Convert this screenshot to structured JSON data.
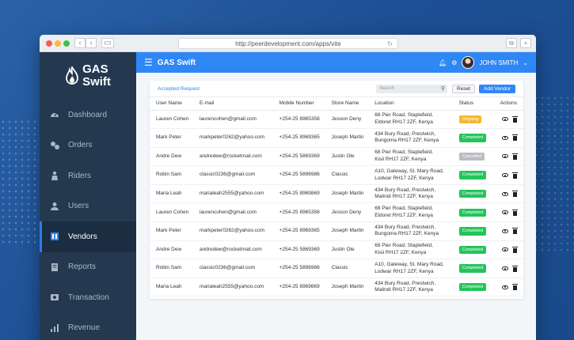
{
  "browser": {
    "url": "http://peerdevelopment.com/apps/vite"
  },
  "brand": {
    "line1": "GAS",
    "line2": "Swift"
  },
  "sidebar": {
    "items": [
      {
        "label": "Dashboard",
        "icon": "gauge-icon"
      },
      {
        "label": "Orders",
        "icon": "orders-icon"
      },
      {
        "label": "Riders",
        "icon": "rider-icon"
      },
      {
        "label": "Users",
        "icon": "user-icon"
      },
      {
        "label": "Vendors",
        "icon": "vendor-icon",
        "active": true
      },
      {
        "label": "Reports",
        "icon": "report-icon"
      },
      {
        "label": "Transaction",
        "icon": "transaction-icon"
      },
      {
        "label": "Revenue",
        "icon": "revenue-icon"
      }
    ]
  },
  "topbar": {
    "title": "GAS Swift",
    "user": "JOHN SMITH"
  },
  "card": {
    "tab": "Accepted Request",
    "search_placeholder": "Search",
    "reset": "Reset",
    "add": "Add Vendor"
  },
  "table": {
    "columns": [
      "User Name",
      "E-mail",
      "Mobile Number",
      "Store Name",
      "Location",
      "Status",
      "Actions"
    ],
    "rows": [
      {
        "name": "Lauren Cohen",
        "email": "laurencohen@gmail.com",
        "mobile": "+254-25 8965358",
        "store": "Jesson Deny",
        "loc1": "68  Pier Road, Staplefield,",
        "loc2": "Eldoret RH17 2ZF, Kenya",
        "status": "Ongoing",
        "cls": "ongoing"
      },
      {
        "name": "Mark Peter",
        "email": "markpeter0262@yahoo.com",
        "mobile": "+254-25 8969365",
        "store": "Joseph Martin",
        "loc1": "434 Bury Road, Prestwich,",
        "loc2": "Bungoma RH17 2ZF, Kenya",
        "status": "Completed",
        "cls": "completed"
      },
      {
        "name": "Andre Dew",
        "email": "andredew@rocketmail.com",
        "mobile": "+254-25 5869369",
        "store": "Justin Ole",
        "loc1": "68  Pier Road, Staplefield,",
        "loc2": "Kisii RH17 2ZF, Kenya",
        "status": "Cancelled",
        "cls": "cancelled"
      },
      {
        "name": "Robin Sam",
        "email": "classic0236@gmail.com",
        "mobile": "+254-25 5896986",
        "store": "Classic",
        "loc1": "A10, Gateway, St. Mary Road,",
        "loc2": "Lodwar RH17 2ZF, Kenya",
        "status": "Completed",
        "cls": "completed"
      },
      {
        "name": "Maria Leah",
        "email": "marialeah2555@yahoo.com",
        "mobile": "+254-25 8969869",
        "store": "Joseph Martin",
        "loc1": "434 Bury Road, Prestwich,",
        "loc2": "Malindi RH17 2ZF, Kenya",
        "status": "Completed",
        "cls": "completed"
      },
      {
        "name": "Lauren Cohen",
        "email": "laurencohen@gmail.com",
        "mobile": "+254-25 8965358",
        "store": "Jesson Deny",
        "loc1": "68  Pier Road, Staplefield,",
        "loc2": "Eldoret RH17 2ZF, Kenya",
        "status": "Completed",
        "cls": "completed"
      },
      {
        "name": "Mark Peter",
        "email": "markpeter0262@yahoo.com",
        "mobile": "+254-25 8969365",
        "store": "Joseph Martin",
        "loc1": "434 Bury Road, Prestwich,",
        "loc2": "Bungoma RH17 2ZF, Kenya",
        "status": "Completed",
        "cls": "completed"
      },
      {
        "name": "Andre Dew",
        "email": "andredew@rocketmail.com",
        "mobile": "+254-25 5869369",
        "store": "Justin Ole",
        "loc1": "68  Pier Road, Staplefield,",
        "loc2": "Kisii RH17 2ZF, Kenya",
        "status": "Completed",
        "cls": "completed"
      },
      {
        "name": "Robin Sam",
        "email": "classic0236@gmail.com",
        "mobile": "+254-25 5896986",
        "store": "Classic",
        "loc1": "A10, Gateway, St. Mary Road,",
        "loc2": "Lodwar RH17 2ZF, Kenya",
        "status": "Completed",
        "cls": "completed"
      },
      {
        "name": "Maria Leah",
        "email": "marialeah2555@yahoo.com",
        "mobile": "+254-25 8969869",
        "store": "Joseph Martin",
        "loc1": "434 Bury Road, Prestwich,",
        "loc2": "Malindi RH17 2ZF, Kenya",
        "status": "Completed",
        "cls": "completed"
      }
    ]
  },
  "colors": {
    "accent": "#2f87f5",
    "sidebar": "#24394f",
    "ongoing": "#f5b82e",
    "completed": "#23c45a",
    "cancelled": "#b9bcc0"
  }
}
